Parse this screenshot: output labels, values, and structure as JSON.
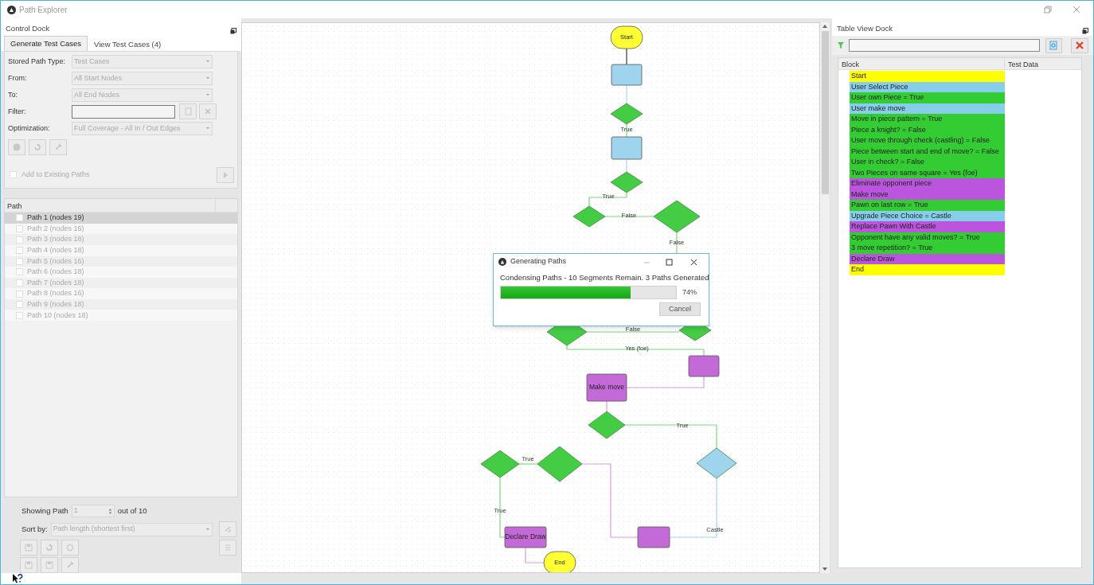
{
  "window": {
    "title": "Path Explorer"
  },
  "control_dock": {
    "title": "Control Dock",
    "tabs": [
      {
        "label": "Generate Test Cases",
        "selected": true
      },
      {
        "label": "View Test Cases (4)",
        "selected": false
      }
    ],
    "fields": [
      {
        "kind": "dropdown",
        "label": "Stored Path Type:",
        "value": "Test Cases"
      },
      {
        "kind": "dropdown",
        "label": "From:",
        "value": "All Start Nodes"
      },
      {
        "kind": "dropdown",
        "label": "To:",
        "value": "All End Nodes"
      },
      {
        "kind": "text",
        "label": "Filter:"
      },
      {
        "kind": "dropdown",
        "label": "Optimization:",
        "value": "Full Coverage - All In / Out Edges"
      }
    ],
    "add_to_existing": {
      "label": "Add to Existing Paths",
      "checked": false
    },
    "path_list": {
      "column": "Path",
      "items": [
        {
          "label": "Path 1 (nodes 19)",
          "selected": true,
          "checked": false
        },
        {
          "label": "Path 2 (nodes 16)",
          "selected": false,
          "checked": false
        },
        {
          "label": "Path 3 (nodes 18)",
          "selected": false,
          "checked": false
        },
        {
          "label": "Path 4 (nodes 18)",
          "selected": false,
          "checked": false
        },
        {
          "label": "Path 5 (nodes 16)",
          "selected": false,
          "checked": false
        },
        {
          "label": "Path 6 (nodes 18)",
          "selected": false,
          "checked": false
        },
        {
          "label": "Path 7 (nodes 18)",
          "selected": false,
          "checked": false
        },
        {
          "label": "Path 8 (nodes 16)",
          "selected": false,
          "checked": false
        },
        {
          "label": "Path 9 (nodes 18)",
          "selected": false,
          "checked": false
        },
        {
          "label": "Path 10 (nodes 18)",
          "selected": false,
          "checked": false
        }
      ]
    },
    "showing_path": {
      "label": "Showing Path",
      "value": "1",
      "suffix": "out of 10"
    },
    "sort_by": {
      "label": "Sort by:",
      "value": "Path length (shortest first)"
    }
  },
  "flowchart": {
    "nodes": [
      {
        "kind": "terminal",
        "label": "Start",
        "color": "#ffff33"
      },
      {
        "kind": "process",
        "color": "#9fd4ef"
      },
      {
        "kind": "decision",
        "color": "#44cc44"
      },
      {
        "kind": "process",
        "color": "#9fd4ef"
      },
      {
        "kind": "decision",
        "color": "#44cc44"
      },
      {
        "kind": "decision",
        "color": "#44cc44"
      },
      {
        "kind": "decision",
        "color": "#44cc44"
      },
      {
        "kind": "decision",
        "color": "#44cc44"
      },
      {
        "kind": "decision",
        "color": "#44cc44"
      },
      {
        "kind": "process",
        "color": "#c36ad8"
      },
      {
        "kind": "process",
        "label": "Make move",
        "color": "#c36ad8"
      },
      {
        "kind": "decision",
        "color": "#44cc44"
      },
      {
        "kind": "decision",
        "color": "#44cc44"
      },
      {
        "kind": "decision",
        "color": "#44cc44"
      },
      {
        "kind": "decision",
        "color": "#9fd4ef"
      },
      {
        "kind": "process",
        "label": "Declare Draw",
        "color": "#c36ad8"
      },
      {
        "kind": "process",
        "color": "#c36ad8"
      },
      {
        "kind": "terminal",
        "label": "End",
        "color": "#ffff33"
      }
    ],
    "edge_labels": [
      "True",
      "True",
      "False",
      "False",
      "False",
      "Yes (foe)",
      "True",
      "True",
      "True",
      "Castle"
    ]
  },
  "progress_dialog": {
    "title": "Generating Paths",
    "message": "Condensing Paths - 10 Segments Remain. 3 Paths Generated",
    "level": 0.74,
    "reading": "74%",
    "buttons": [
      "Cancel"
    ]
  },
  "table_view_dock": {
    "title": "Table View Dock",
    "columns": [
      "Block",
      "Test Data"
    ],
    "rows": [
      {
        "block": "Start",
        "color": "#ffff00"
      },
      {
        "block": "User Select Piece",
        "color": "#87ceeb"
      },
      {
        "block": "User own Piece = True",
        "color": "#33cc33"
      },
      {
        "block": "User make move",
        "color": "#87ceeb"
      },
      {
        "block": "Move in piece pattern = True",
        "color": "#33cc33"
      },
      {
        "block": "Piece a knight? = False",
        "color": "#33cc33"
      },
      {
        "block": "User move through check (castling) = False",
        "color": "#33cc33"
      },
      {
        "block": "Piece between start and end of move? = False",
        "color": "#33cc33"
      },
      {
        "block": "User in check? = False",
        "color": "#33cc33"
      },
      {
        "block": "Two Pieces on same square = Yes (foe)",
        "color": "#33cc33"
      },
      {
        "block": "Eliminate opponent piece",
        "color": "#bb55dd"
      },
      {
        "block": "Make move",
        "color": "#bb55dd"
      },
      {
        "block": "Pawn on last row = True",
        "color": "#33cc33"
      },
      {
        "block": "Upgrade Piece Choice = Castle",
        "color": "#87ceeb"
      },
      {
        "block": "Replace Pawn With Castle",
        "color": "#bb55dd"
      },
      {
        "block": "Opponent have any valid moves? = True",
        "color": "#33cc33"
      },
      {
        "block": "3 move repetition? = True",
        "color": "#33cc33"
      },
      {
        "block": "Declare Draw",
        "color": "#bb55dd"
      },
      {
        "block": "End",
        "color": "#ffff00"
      }
    ]
  }
}
